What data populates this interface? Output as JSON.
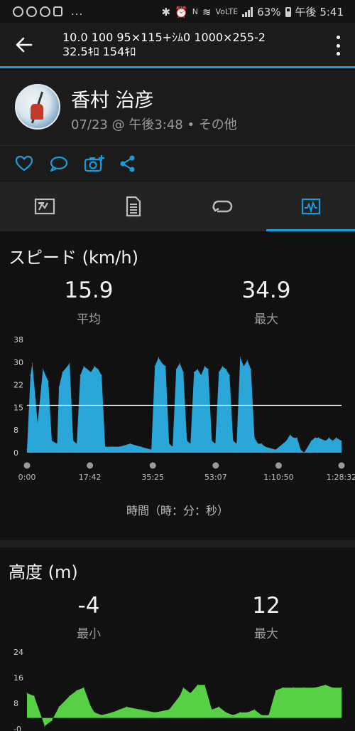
{
  "status_bar": {
    "battery_pct": "63%",
    "time": "午後 5:41",
    "more": "...",
    "nfc": "N",
    "volte": "VoLTE"
  },
  "app_bar": {
    "title_line1": "10.0 100 95×115+ｼﾑ0 1000×255-2",
    "title_line2": "32.5ｷﾛ 154ｷﾛ"
  },
  "profile": {
    "name": "香村 治彦",
    "subtitle": "07/23 @ 午後3:48 • その他"
  },
  "actions": [
    "heart-icon",
    "comment-icon",
    "camera-add-icon",
    "share-icon"
  ],
  "tabs": [
    {
      "icon": "overview-map-icon",
      "active": false
    },
    {
      "icon": "details-document-icon",
      "active": false
    },
    {
      "icon": "laps-loop-icon",
      "active": false
    },
    {
      "icon": "charts-pulse-icon",
      "active": true
    }
  ],
  "speed": {
    "title": "スピード (km/h)",
    "avg_value": "15.9",
    "avg_label": "平均",
    "max_value": "34.9",
    "max_label": "最大",
    "xlabel": "時間（時：分：秒）"
  },
  "altitude": {
    "title": "高度 (m)",
    "min_value": "-4",
    "min_label": "最小",
    "max_value": "12",
    "max_label": "最大"
  },
  "colors": {
    "accent": "#1d9bd6",
    "speed_fill": "#2aa6d8",
    "altitude_fill": "#57d045",
    "average_line": "#ffffff"
  },
  "chart_data": [
    {
      "type": "area",
      "title": "スピード (km/h)",
      "xlabel": "時間（時：分：秒）",
      "ylabel": "",
      "ylim": [
        0,
        38
      ],
      "yticks": [
        "0",
        "8",
        "15",
        "22",
        "30",
        "38"
      ],
      "xticks": [
        "0:00",
        "17:42",
        "35:25",
        "53:07",
        "1:10:50",
        "1:28:32"
      ],
      "average": 15.9,
      "grid": false,
      "x_minutes": [
        0,
        1,
        1.5,
        3,
        4.5,
        6,
        7,
        8.5,
        9,
        10,
        12,
        13,
        14,
        15,
        16,
        17,
        18,
        19,
        20,
        21,
        22,
        24,
        26,
        29,
        32,
        35,
        36,
        37,
        38,
        39,
        40,
        41,
        42,
        43,
        44,
        45,
        46,
        47,
        48,
        49,
        50,
        51,
        52,
        53,
        54,
        55,
        56,
        57,
        58,
        59,
        60,
        61,
        62,
        63,
        64,
        65,
        66,
        67,
        70,
        73,
        74,
        75,
        76,
        77,
        78,
        80,
        81,
        82,
        84,
        85,
        86,
        87,
        88.5
      ],
      "values": [
        1,
        26,
        30,
        10,
        28,
        24,
        4,
        3,
        22,
        27,
        30,
        4,
        3,
        26,
        29,
        28,
        27,
        29,
        28,
        26,
        2,
        2,
        2,
        3,
        2,
        1,
        29,
        32,
        30,
        29,
        3,
        2,
        28,
        30,
        27,
        4,
        3,
        27,
        28,
        26,
        29,
        28,
        4,
        3,
        27,
        29,
        28,
        26,
        4,
        3,
        32,
        29,
        31,
        28,
        5,
        3,
        3,
        2,
        1,
        4,
        6,
        5,
        5,
        1,
        0,
        4,
        5,
        5,
        4,
        5,
        4,
        5,
        4
      ]
    },
    {
      "type": "area",
      "title": "高度 (m)",
      "xlabel": "",
      "ylabel": "",
      "ylim": [
        -4,
        24
      ],
      "yticks": [
        "-0",
        "8",
        "16",
        "24"
      ],
      "x_minutes": [
        0,
        2,
        5,
        7,
        9,
        12,
        14,
        16,
        18,
        19,
        21,
        24,
        26,
        28,
        32,
        36,
        40,
        43,
        44,
        46,
        48,
        50,
        52,
        54,
        56,
        58,
        60,
        62,
        64,
        66,
        68,
        70,
        72,
        75,
        78,
        81,
        84,
        86,
        88.5
      ],
      "values": [
        9,
        8,
        -3,
        -1,
        4,
        8,
        10,
        11,
        4,
        2,
        1,
        2,
        3,
        4,
        3,
        2,
        3,
        8,
        11,
        9,
        12,
        12,
        3,
        4,
        2,
        1,
        2,
        2,
        3,
        1,
        1,
        10,
        11,
        11,
        11,
        11,
        12,
        11,
        11
      ]
    }
  ]
}
